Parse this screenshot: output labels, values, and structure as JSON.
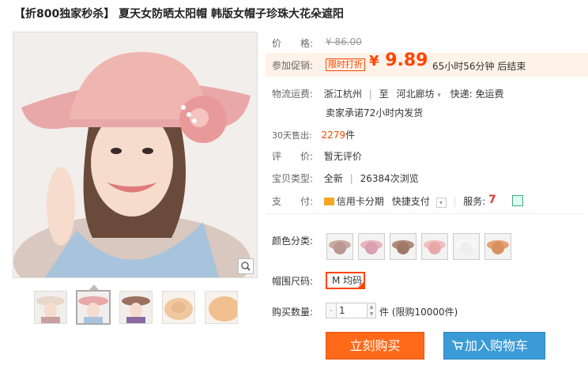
{
  "product": {
    "title": "【折800独家秒杀】 夏天女防晒太阳帽 韩版女帽子珍珠大花朵遮阳"
  },
  "price": {
    "label": "价　　格:",
    "original": "¥ 86.00"
  },
  "promo": {
    "label": "参加促销:",
    "tag": "限时打折",
    "currency": "¥",
    "price": "9.89",
    "countdown": "65小时56分钟 后结束"
  },
  "shipping": {
    "label": "物流运费:",
    "from": "浙江杭州",
    "to_prefix": "至",
    "to": "河北廊坊",
    "to_arrow": "▾",
    "fee": "快递: 免运费",
    "promise": "卖家承诺72小时内发货"
  },
  "sales": {
    "label": "30天售出:",
    "count": "2279",
    "unit": "件"
  },
  "rating": {
    "label": "评　　价:",
    "value": "暂无评价"
  },
  "type": {
    "label": "宝贝类型:",
    "condition": "全新",
    "views": "26384次浏览"
  },
  "payment": {
    "label": "支　　付:",
    "credit": "信用卡分期",
    "quick": "快捷支付",
    "service_label": "服务:",
    "service_icon_text": "7"
  },
  "options": {
    "color_label": "颜色分类:",
    "size_label": "帽围尺码:",
    "size_value": "M 均码",
    "swatch_colors": [
      "#c9a9a0",
      "#e6b5c0",
      "#b08a7a",
      "#f0c0c0",
      "#f2f2f2",
      "#e8a070"
    ]
  },
  "quantity": {
    "label": "购买数量:",
    "minus": "-",
    "value": "1",
    "up": "▲",
    "down": "▼",
    "limit": "件 (限购10000件)"
  },
  "buttons": {
    "buy": "立刻购买",
    "cart": "加入购物车"
  },
  "colors": {
    "accent": "#ff4400",
    "buy_button": "#ff6a1a",
    "cart_button": "#3b9bd6"
  }
}
